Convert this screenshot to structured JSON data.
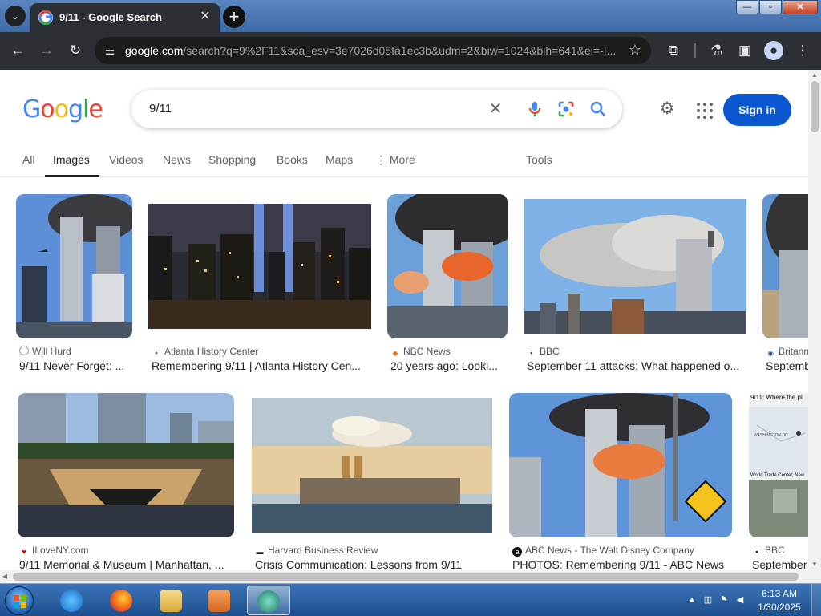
{
  "browser": {
    "tab_title": "9/11 - Google Search",
    "tab_close": "✕",
    "new_tab": "+",
    "url_host": "google.com",
    "url_rest": "/search?q=9%2F11&sca_esv=3e7026d05fa1ec3b&udm=2&biw=1024&bih=641&ei=-I...",
    "window_buttons": {
      "minimize": "—",
      "maximize": "▫",
      "close": "✕"
    }
  },
  "google": {
    "logo_letters": [
      "G",
      "o",
      "o",
      "g",
      "l",
      "e"
    ],
    "logo_colors": [
      "#4285F4",
      "#EA4335",
      "#FBBC05",
      "#4285F4",
      "#34A853",
      "#EA4335"
    ],
    "query": "9/11",
    "sign_in": "Sign in",
    "nav": [
      "All",
      "Images",
      "Videos",
      "News",
      "Shopping",
      "Books",
      "Maps",
      "⋮ More",
      "Tools"
    ],
    "active_nav": "Images"
  },
  "results": [
    {
      "source": "Will Hurd",
      "title": "9/11 Never Forget: ...",
      "fav_color": "#9aa0a6"
    },
    {
      "source": "Atlanta History Center",
      "title": "Remembering 9/11 | Atlanta History Cen...",
      "fav_color": "#3b5998"
    },
    {
      "source": "NBC News",
      "title": "20 years ago: Looki...",
      "fav_color": "#f37021"
    },
    {
      "source": "BBC",
      "title": "September 11 attacks: What happened o...",
      "fav_color": "#000000"
    },
    {
      "source": "Britann",
      "title": "Septemb",
      "fav_color": "#2a5d8f"
    },
    {
      "source": "ILoveNY.com",
      "title": "9/11 Memorial & Museum | Manhattan, ...",
      "fav_color": "#d50000"
    },
    {
      "source": "Harvard Business Review",
      "title": "Crisis Communication: Lessons from 9/11",
      "fav_color": "#222222"
    },
    {
      "source": "ABC News - The Walt Disney Company",
      "title": "PHOTOS: Remembering 9/11 - ABC News",
      "fav_color": "#111111"
    },
    {
      "source": "BBC",
      "title": "September",
      "fav_color": "#000000"
    }
  ],
  "map_thumb": {
    "title": "9/11: Where the pl",
    "label1": "WASHINGTON DC",
    "label2": "World Trade Center, New"
  },
  "taskbar": {
    "time": "6:13 AM",
    "date": "1/30/2025"
  }
}
